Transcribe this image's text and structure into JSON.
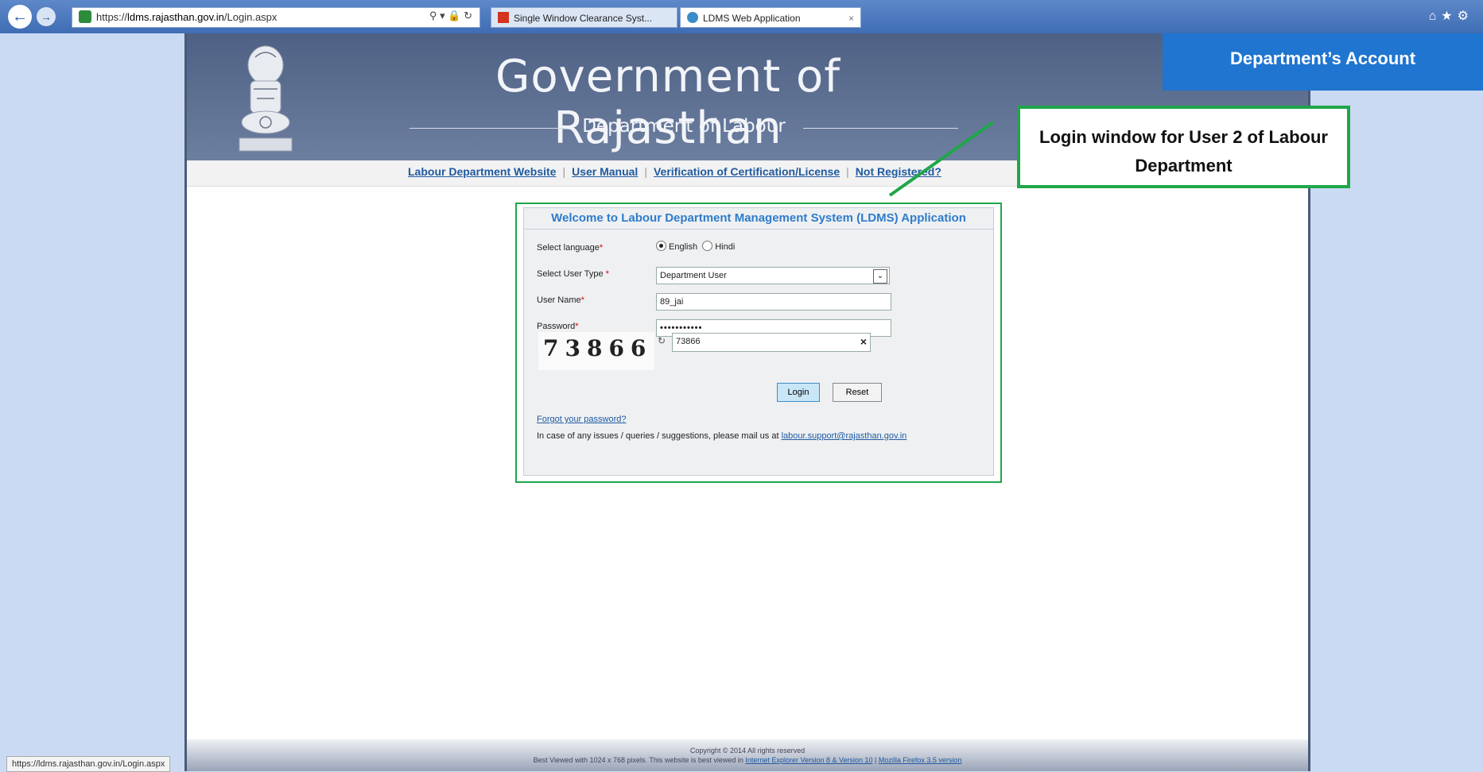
{
  "browser": {
    "url_prefix": "https://",
    "url_host": "ldms.rajasthan.gov.in",
    "url_path": "/Login.aspx",
    "tabs": [
      {
        "label": "Single Window Clearance Syst..."
      },
      {
        "label": "LDMS Web Application"
      }
    ],
    "status_url": "https://ldms.rajasthan.gov.in/Login.aspx"
  },
  "header": {
    "title": "Government of Rajasthan",
    "subtitle": "Department of Labour"
  },
  "nav": {
    "links": [
      "Labour Department Website",
      "User Manual",
      "Verification of Certification/License",
      "Not Registered?"
    ]
  },
  "login": {
    "heading": "Welcome to Labour Department Management System (LDMS) Application",
    "language_label": "Select language",
    "language_options": [
      "English",
      "Hindi"
    ],
    "user_type_label": "Select User Type",
    "user_type_value": "Department User",
    "username_label": "User Name",
    "username_value": "89_jai",
    "password_label": "Password",
    "password_value": "•••••••••••",
    "captcha_text": "73866",
    "captcha_input": "73866",
    "login_button": "Login",
    "reset_button": "Reset",
    "forgot_link": "Forgot your password?",
    "contact_text": "In case of any issues / queries / suggestions, please mail us at",
    "contact_email": "labour.support@rajasthan.gov.in"
  },
  "footer": {
    "copyright": "Copyright © 2014 All rights reserved",
    "best_viewed": "Best Viewed with 1024 x 768 pixels. This website is best viewed in",
    "browser_link": "Internet Explorer Version 8 & Version 10",
    "firefox_link": "Mozilla Firefox 3.5 version"
  },
  "annotations": {
    "banner": "Department’s Account",
    "callout": "Login window for User 2 of Labour Department",
    "highlight_color": "#1fa64a",
    "banner_color": "#1f75d0"
  }
}
